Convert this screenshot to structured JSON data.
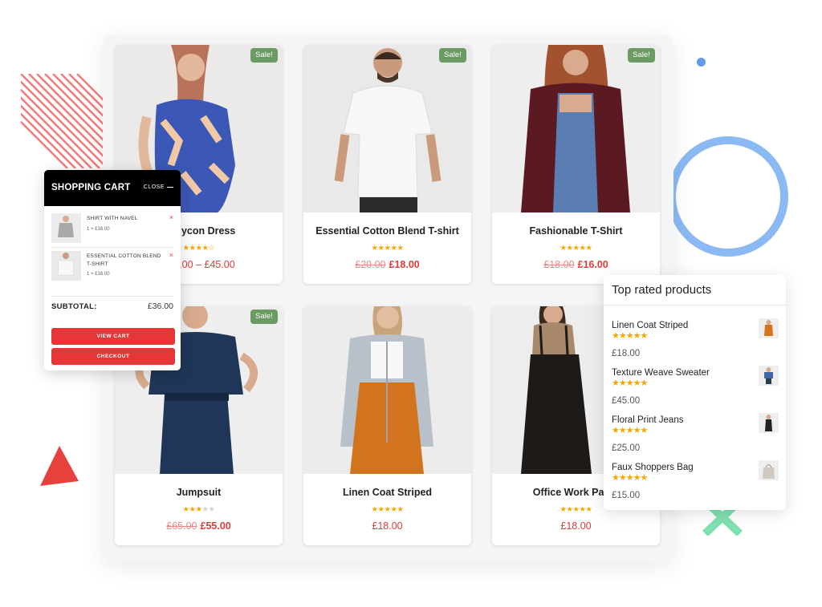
{
  "products": [
    {
      "title": "Bodycon Dress",
      "price_range": "£35.00 – £45.00",
      "sale_badge": "Sale!",
      "rating_stars": "★★★★☆",
      "rating": 4
    },
    {
      "title": "Essential Cotton Blend T-shirt",
      "old_price": "£20.00",
      "price": "£18.00",
      "sale_badge": "Sale!",
      "rating_stars": "★★★★★",
      "rating": 4.5
    },
    {
      "title": "Fashionable T-Shirt",
      "old_price": "£18.00",
      "price": "£16.00",
      "sale_badge": "Sale!",
      "rating_stars": "★★★★★",
      "rating": 4.5
    },
    {
      "title": "Jumpsuit",
      "old_price": "£65.00",
      "price": "£55.00",
      "sale_badge": "Sale!",
      "rating_stars": "★★★",
      "rating_empty": "★★",
      "rating": 3.5
    },
    {
      "title": "Linen Coat Striped",
      "price": "£18.00",
      "rating_stars": "★★★★★",
      "rating": 5
    },
    {
      "title": "Office Work Pants",
      "price": "£18.00",
      "rating_stars": "★★★★★",
      "rating": 4.5
    }
  ],
  "cart": {
    "title": "SHOPPING CART",
    "close_label": "CLOSE",
    "remove_icon": "×",
    "items": [
      {
        "name": "SHIRT WITH NAVEL",
        "qty": "1 × £18.00"
      },
      {
        "name": "ESSENTIAL COTTON BLEND T-SHIRT",
        "qty": "1 × £18.00"
      }
    ],
    "subtotal_label": "SUBTOTAL:",
    "subtotal_value": "£36.00",
    "view_cart_label": "VIEW CART",
    "checkout_label": "CHECKOUT",
    "button_color": "#e53737"
  },
  "top_rated": {
    "title": "Top rated products",
    "items": [
      {
        "name": "Linen Coat Striped",
        "stars": "★★★★★",
        "rating": 5,
        "price": "£18.00"
      },
      {
        "name": "Texture Weave Sweater",
        "stars": "★★★★★",
        "rating": 4.5,
        "price": "£45.00"
      },
      {
        "name": "Floral Print Jeans",
        "stars": "★★★★★",
        "rating": 4.5,
        "price": "£25.00"
      },
      {
        "name": "Faux Shoppers Bag",
        "stars": "★★★★★",
        "rating": 4.5,
        "price": "£15.00"
      }
    ]
  },
  "colors": {
    "accent_red": "#e53737",
    "price_red": "#e03c3c",
    "sale_green": "#6b9a63",
    "star_gold": "#f2a900",
    "deco_blue": "#8ab9f4",
    "deco_green": "#7fe0b0"
  }
}
